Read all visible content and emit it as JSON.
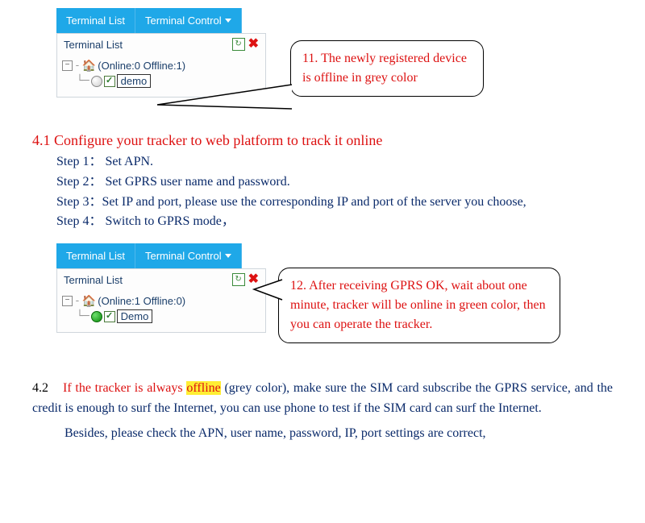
{
  "panel1": {
    "tabs": {
      "list": "Terminal List",
      "control": "Terminal Control"
    },
    "header": "Terminal List",
    "tree_root": "(Online:0  Offline:1)",
    "item_label": "demo"
  },
  "callout1": "11. The newly registered device is offline in grey color",
  "section41": {
    "title": "4.1 Configure your tracker to web platform to track it online",
    "step1": "Step 1： Set APN.",
    "step2": "Step 2： Set GPRS user name and password.",
    "step3": "Step 3：Set IP and port, please use the corresponding IP and port of the server you choose,",
    "step4": "Step 4： Switch to GPRS mode，"
  },
  "panel2": {
    "tabs": {
      "list": "Terminal List",
      "control": "Terminal Control"
    },
    "header": "Terminal List",
    "tree_root": "(Online:1  Offline:0)",
    "item_label": "Demo"
  },
  "callout2": "12. After receiving GPRS OK, wait about one minute, tracker will be online in green color, then you can operate the tracker.",
  "section42": {
    "num": "4.2",
    "red_lead": "If the tracker is always",
    "hl": "offline",
    "rest": " (grey color), make sure the SIM card subscribe the GPRS service, and the credit is enough to surf the Internet, you can use phone to test if the SIM card can surf the Internet.",
    "besides": "Besides, please check the APN, user name, password, IP, port settings are correct,"
  }
}
